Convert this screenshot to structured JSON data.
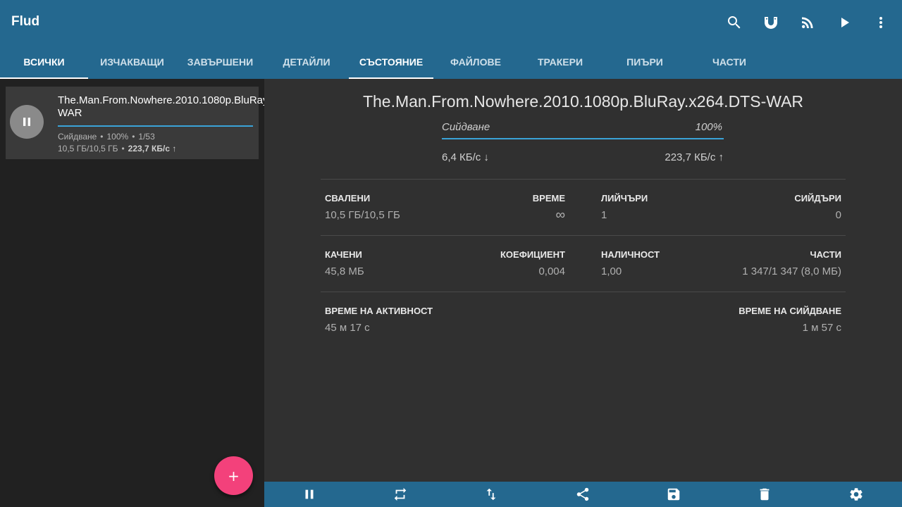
{
  "app": {
    "title": "Flud"
  },
  "appbar_icons": [
    "search-icon",
    "magnet-icon",
    "rss-icon",
    "play-icon",
    "more-vert-icon"
  ],
  "left_tabs": [
    {
      "label": "ВСИЧКИ",
      "active": true
    },
    {
      "label": "ИЗЧАКВАЩИ",
      "active": false
    },
    {
      "label": "ЗАВЪРШЕНИ",
      "active": false
    }
  ],
  "right_tabs": [
    {
      "label": "ДЕТАЙЛИ",
      "active": false
    },
    {
      "label": "СЪСТОЯНИЕ",
      "active": true
    },
    {
      "label": "ФАЙЛОВЕ",
      "active": false
    },
    {
      "label": "ТРАКЕРИ",
      "active": false
    },
    {
      "label": "ПИЪРИ",
      "active": false
    },
    {
      "label": "ЧАСТИ",
      "active": false
    }
  ],
  "torrent": {
    "name": "The.Man.From.Nowhere.2010.1080p.BluRay.x264.DTS-WAR",
    "progress": 1.0,
    "status": "Сийдване",
    "percent": "100%",
    "files": "1/53",
    "size": "10,5 ГБ/10,5 ГБ",
    "upload_speed": "223,7 КБ/с ↑",
    "dot": "•"
  },
  "fab": {
    "label": "+"
  },
  "detail": {
    "title": "The.Man.From.Nowhere.2010.1080p.BluRay.x264.DTS-WAR",
    "status_label": "Сийдване",
    "status_percent": "100%",
    "speed_down": "6,4 КБ/с ↓",
    "speed_up": "223,7 КБ/с ↑",
    "stats": {
      "downloaded_label": "СВАЛЕНИ",
      "downloaded_value": "10,5 ГБ/10,5 ГБ",
      "time_label": "ВРЕМЕ",
      "time_value": "∞",
      "leechers_label": "ЛИЙЧЪРИ",
      "leechers_value": "1",
      "seeders_label": "СИЙДЪРИ",
      "seeders_value": "0",
      "uploaded_label": "КАЧЕНИ",
      "uploaded_value": "45,8 МБ",
      "ratio_label": "КОЕФИЦИЕНТ",
      "ratio_value": "0,004",
      "availability_label": "НАЛИЧНОСТ",
      "availability_value": "1,00",
      "pieces_label": "ЧАСТИ",
      "pieces_value": "1 347/1 347 (8,0 МБ)",
      "active_time_label": "ВРЕМЕ НА АКТИВНОСТ",
      "active_time_value": "45 м 17 с",
      "seeding_time_label": "ВРЕМЕ НА СИЙДВАНЕ",
      "seeding_time_value": "1 м 57 с"
    }
  },
  "bottombar_icons": [
    "pause-icon",
    "repeat-icon",
    "swap-vert-icon",
    "share-icon",
    "save-icon",
    "delete-icon",
    "settings-icon"
  ],
  "colors": {
    "primary": "#24688f",
    "accent": "#f3417b",
    "progress": "#3aa3d8"
  }
}
